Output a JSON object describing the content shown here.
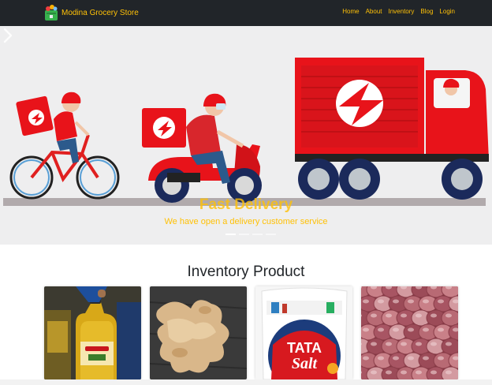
{
  "navbar": {
    "brand_name": "Modina Grocery Store",
    "links": [
      "Home",
      "About",
      "Inventory",
      "Blog",
      "Login"
    ],
    "accent_color": "#ffc107",
    "background_color": "#212529"
  },
  "carousel": {
    "caption_title": "Fast Delivery",
    "caption_text": "We have open a delivery customer service",
    "slide_count": 4,
    "active_slide": 1,
    "next_icon": "chevron-right-icon"
  },
  "inventory": {
    "title": "Inventory Product",
    "products": [
      {
        "image": "cooking-oil-bottles"
      },
      {
        "image": "ginger-root"
      },
      {
        "image": "tata-salt-packet",
        "brand": "TATA",
        "product": "Salt"
      },
      {
        "image": "red-onions"
      }
    ]
  }
}
